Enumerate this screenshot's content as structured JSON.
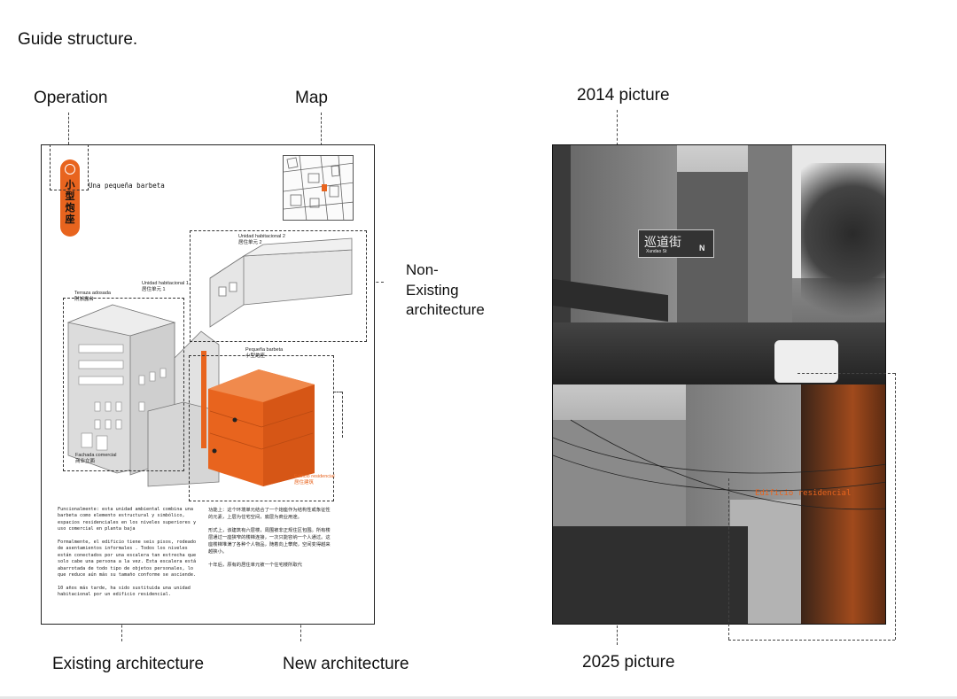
{
  "title": "Guide structure.",
  "labels": {
    "operation": "Operation",
    "map": "Map",
    "non_existing": [
      "Non-",
      "Existing",
      "architecture"
    ],
    "existing": "Existing architecture",
    "new_arch": "New architecture",
    "pic2014": "2014 picture",
    "pic2025": "2025 picture"
  },
  "guide_page": {
    "badge_chars": [
      "小",
      "型",
      "炮",
      "座"
    ],
    "badge_subtitle": "Una pequeña barbeta",
    "unit2_es": "Unidad habitacional 2",
    "unit2_zh": "居住单元 2",
    "unit1_es": "Unidad habitacional 1",
    "unit1_zh": "居住单元 1",
    "terrace_es": "Terraza adosada",
    "terrace_zh": "附加露台",
    "barbeta_es": "Pequeña barbeta",
    "barbeta_zh": "小型炮座",
    "facade_es": "Fachada comercial",
    "facade_zh": "商业立面",
    "resid_es": "Edificio residencial",
    "resid_zh": "居住建筑",
    "text_es": [
      "Funcionalmente: esta unidad ambiental combina una",
      "barbeta como elemento estructural y simbólico,",
      "espacios residenciales en los niveles superiores y",
      "uso comercial en planta baja",
      "",
      "Formalmente, el edificio tiene seis pisos, rodeado",
      "de asentamientos informales . Todos los niveles",
      "están conectados por una escalera tan estrecha que",
      "solo cabe una persona a la vez. Esta escalera está",
      "abarrotada de todo tipo de objetos personales, lo",
      "que reduce aún más su tamaño conforme se asciende.",
      "",
      "10 años más tarde, ha sido sustituida una unidad",
      "habitacional por un edificio residencial."
    ],
    "text_zh": [
      "功能上：这个环境单元结合了一个炮座作为结构性或象征性",
      "的元素，上层为住宅空间，底层为商业用途。",
      "",
      "形式上，该建筑有六层楼，周围被非正规住区包围。所有楼",
      "层通过一座狭窄的楼梯连接，一次只能容纳一个人通过。这",
      "座楼梯堆满了各种个人物品，随着向上攀爬，空间变得越来",
      "越狭小。",
      "",
      "十年后，原有的居住单元被一个住宅楼所取代"
    ]
  },
  "photos": {
    "street_sign_zh": "巡道街",
    "street_sign_en": "Xundao St",
    "street_sign_dir": "N",
    "overlay_label": "Edificio residencial"
  },
  "colors": {
    "accent": "#e8641e",
    "building_gray": "#d9d9d9",
    "line": "#444444"
  }
}
